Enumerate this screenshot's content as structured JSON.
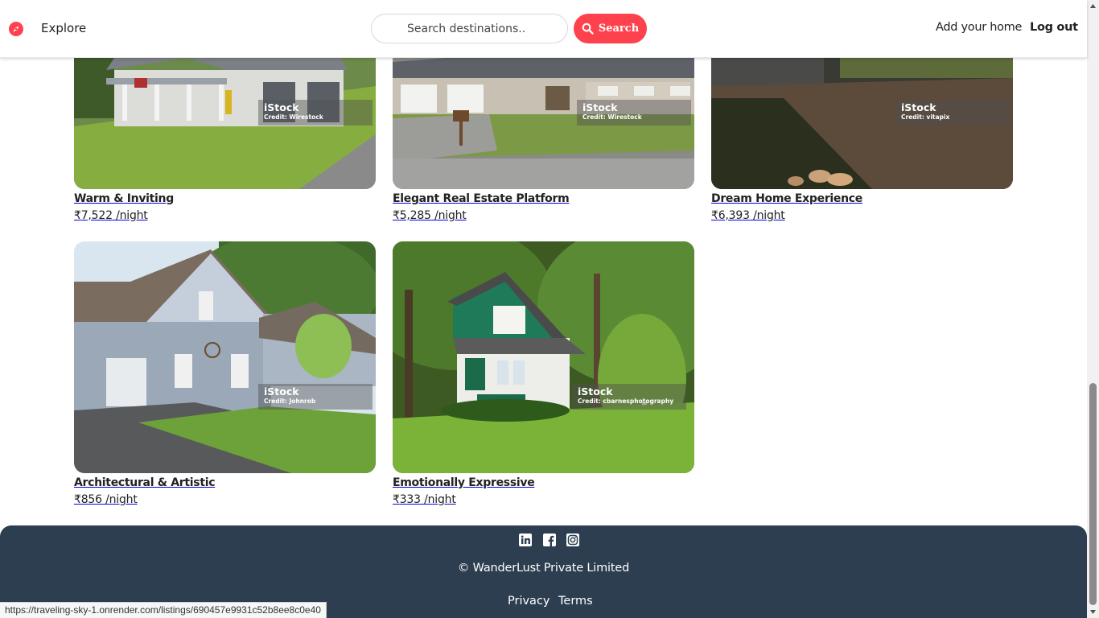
{
  "navbar": {
    "explore_label": "Explore",
    "search_placeholder": "Search destinations..",
    "search_button_label": "Search",
    "add_home_label": "Add your home",
    "logout_label": "Log out",
    "brand_color": "#fe424d"
  },
  "listings": [
    {
      "title": "Warm & Inviting",
      "currency": "₹",
      "price": "7,522",
      "per": " /night",
      "watermark": "iStock",
      "credit": "Credit: Wirestock"
    },
    {
      "title": "Elegant Real Estate Platform",
      "currency": "₹",
      "price": "5,285",
      "per": " /night",
      "watermark": "iStock",
      "credit": "Credit: Wirestock"
    },
    {
      "title": "Dream Home Experience",
      "currency": "₹",
      "price": "6,393",
      "per": " /night",
      "watermark": "iStock",
      "credit": "Credit: vitapix"
    },
    {
      "title": "Architectural & Artistic",
      "currency": "₹",
      "price": "856",
      "per": " /night",
      "watermark": "iStock",
      "credit": "Credit: Johnrob"
    },
    {
      "title": "Emotionally Expressive",
      "currency": "₹",
      "price": "333",
      "per": " /night",
      "watermark": "iStock",
      "credit": "Credit: cbarnesphotography"
    }
  ],
  "footer": {
    "social_icons": [
      "linkedin-icon",
      "facebook-icon",
      "instagram-icon"
    ],
    "copyright": "© WanderLust Private Limited",
    "privacy_label": "Privacy",
    "terms_label": "Terms",
    "background_color": "#2c3e50"
  },
  "status_bar": {
    "url": "https://traveling-sky-1.onrender.com/listings/690457e9931c52b8ee8c0e40"
  }
}
